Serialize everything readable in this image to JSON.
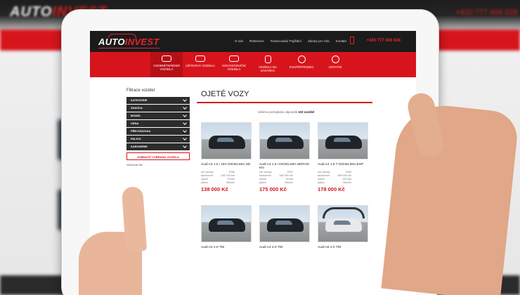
{
  "site": {
    "logo_part1": "AUTO",
    "logo_part2": "INVEST",
    "phone": "+420 777 666 628"
  },
  "nav": [
    "O nás",
    "Reference",
    "Financování/ Pojištění",
    "Záruky pro Vás",
    "Kontakt"
  ],
  "categories": [
    {
      "label": "OSOBNÍ/TERÉNNÍ VOZIDLA",
      "icon": "car-icon"
    },
    {
      "label": "UŽITKOVÁ VOZIDLA",
      "icon": "van-icon"
    },
    {
      "label": "NOVÁ/ZÁRUČNÍ VOZIDLA",
      "icon": "new-car-icon"
    },
    {
      "label": "VOZIDLA NA ZAKÁZKU",
      "icon": "calculator-icon"
    },
    {
      "label": "KOUPĚ/PRODEJ",
      "icon": "key-icon"
    },
    {
      "label": "OSTATNÍ",
      "icon": "wheel-icon"
    }
  ],
  "filter": {
    "title": "Filtrace vozidel",
    "rows": [
      "KATEGORIE",
      "ZNAČKA",
      "MODEL",
      "CENA",
      "PŘEVODOVKA",
      "PALIVO",
      "KAROSERIE"
    ],
    "show_button": "ZOBRAZIT VYBRANÁ VOZIDLA",
    "reset": "resetovat filtr"
  },
  "main": {
    "title": "OJETÉ VOZY",
    "count_prefix": "Vašemu požadavku odpovídá",
    "count_value": "103 vozidel"
  },
  "cars": [
    {
      "name": "Audi A3 1.6 i 16V DIGIKLIMA,SD",
      "year": "2006",
      "km": "128 193 km",
      "power": "75 kW",
      "fuel": "Benzin",
      "price": "138 000 Kč"
    },
    {
      "name": "Audi A4 1.6 i DIGIKLIMA SERVIS KN",
      "year": "2007",
      "km": "148 000 km",
      "power": "75 kW",
      "fuel": "Benzin",
      "price": "175 000 Kč"
    },
    {
      "name": "Audi A4 1.8 T DIGIKLIMA,ESP",
      "year": "2006",
      "km": "168 000 km",
      "power": "120 kW",
      "fuel": "Benzin",
      "price": "178 000 Kč"
    },
    {
      "name": "Audi A4 2.0 TDI",
      "year": "",
      "km": "",
      "power": "",
      "fuel": "",
      "price": ""
    },
    {
      "name": "Audi A4 2.0 TDI",
      "year": "",
      "km": "",
      "power": "",
      "fuel": "",
      "price": ""
    },
    {
      "name": "Audi A6 2.0 TDI",
      "year": "",
      "km": "",
      "power": "",
      "fuel": "",
      "price": ""
    }
  ],
  "spec_labels": {
    "year": "rok výroby",
    "km": "tachometr",
    "power": "výkon",
    "fuel": "palivo"
  }
}
